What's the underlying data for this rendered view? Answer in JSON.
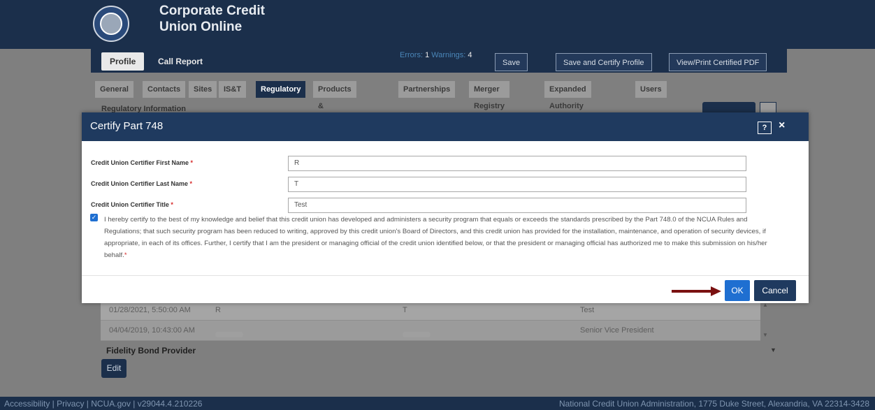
{
  "header": {
    "title_line1": "Corporate Credit",
    "title_line2": "Union Online",
    "tabs": [
      "Profile",
      "Call Report"
    ],
    "errors_label": "Errors:",
    "errors_count": "1",
    "warnings_label": "Warnings:",
    "warnings_count": "4",
    "buttons": [
      "Save",
      "Save and Certify Profile",
      "View/Print Certified PDF"
    ]
  },
  "subtabs": [
    "General",
    "Contacts",
    "Sites",
    "IS&T",
    "Regulatory",
    "Products & Services",
    "Partnerships",
    "Merger Registry",
    "Expanded Authority",
    "Users"
  ],
  "section_title": "Regulatory Information",
  "background_rows": [
    {
      "date": "01/28/2021, 5:50:00 AM",
      "first": "R",
      "last": "T",
      "title": "Test"
    },
    {
      "date": "04/04/2019, 10:43:00 AM",
      "first": "",
      "last": "",
      "title": "Senior Vice President"
    }
  ],
  "fidelity_label": "Fidelity Bond Provider",
  "edit_label": "Edit",
  "modal": {
    "title": "Certify Part 748",
    "help_label": "?",
    "close_label": "×",
    "fields": [
      {
        "label": "Credit Union Certifier First Name",
        "value": "R"
      },
      {
        "label": "Credit Union Certifier Last Name",
        "value": "T"
      },
      {
        "label": "Credit Union Certifier Title",
        "value": "Test"
      }
    ],
    "required_mark": "*",
    "certification_text": "I hereby certify to the best of my knowledge and belief that this credit union has developed and administers a security program that equals or exceeds the standards prescribed by the Part 748.0 of the NCUA Rules and Regulations; that such security program has been reduced to writing, approved by this credit union's Board of Directors, and this credit union has provided for the installation, maintenance, and operation of security devices, if appropriate, in each of its offices. Further, I certify that I am the president or managing official of the credit union identified below, or that the president or managing official has authorized me to make this submission on his/her behalf.",
    "certification_checked": true,
    "ok_label": "OK",
    "cancel_label": "Cancel",
    "arrow_color": "#7a1010"
  },
  "footer": {
    "left": "Accessibility | Privacy | NCUA.gov | v29044.4.210226",
    "right": "National Credit Union Administration, 1775 Duke Street, Alexandria, VA 22314-3428"
  }
}
